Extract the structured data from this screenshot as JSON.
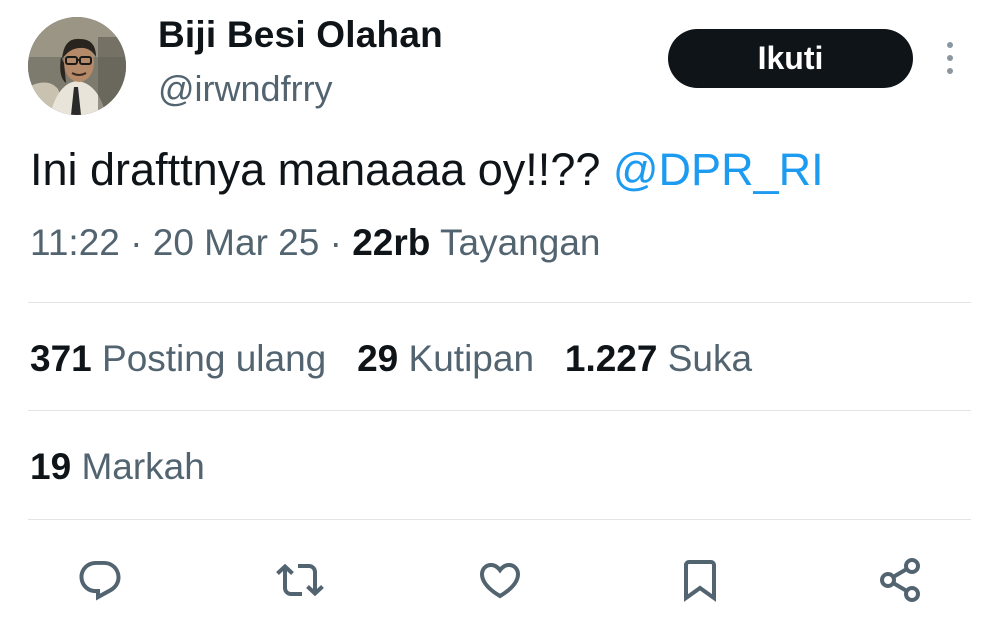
{
  "tweet": {
    "author": {
      "display_name": "Biji Besi Olahan",
      "handle": "@irwndfrry"
    },
    "follow_label": "Ikuti",
    "text": "Ini drafttnya manaaaa oy!!?? ",
    "mention": "@DPR_RI",
    "time": "11:22",
    "date": "20 Mar 25",
    "separator": " · ",
    "views_count": "22rb",
    "views_label": "Tayangan",
    "stats": {
      "reposts_count": "371",
      "reposts_label": "Posting ulang",
      "quotes_count": "29",
      "quotes_label": "Kutipan",
      "likes_count": "1.227",
      "likes_label": "Suka",
      "bookmarks_count": "19",
      "bookmarks_label": "Markah"
    }
  },
  "icons": {
    "more": "more-vertical-icon",
    "reply": "reply-icon",
    "repost": "repost-icon",
    "like": "heart-icon",
    "bookmark": "bookmark-icon",
    "share": "share-icon"
  },
  "colors": {
    "text": "#0f1419",
    "secondary": "#536471",
    "mention": "#1d9bf0",
    "button_bg": "#0f1419",
    "button_text": "#ffffff",
    "divider": "#e1e5e8"
  }
}
